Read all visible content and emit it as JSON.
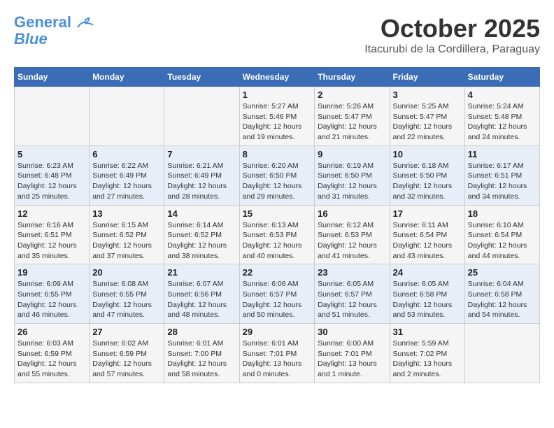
{
  "header": {
    "logo_line1": "General",
    "logo_line2": "Blue",
    "title": "October 2025",
    "subtitle": "Itacurubi de la Cordillera, Paraguay"
  },
  "weekdays": [
    "Sunday",
    "Monday",
    "Tuesday",
    "Wednesday",
    "Thursday",
    "Friday",
    "Saturday"
  ],
  "weeks": [
    [
      {
        "day": "",
        "info": ""
      },
      {
        "day": "",
        "info": ""
      },
      {
        "day": "",
        "info": ""
      },
      {
        "day": "1",
        "info": "Sunrise: 5:27 AM\nSunset: 5:46 PM\nDaylight: 12 hours\nand 19 minutes."
      },
      {
        "day": "2",
        "info": "Sunrise: 5:26 AM\nSunset: 5:47 PM\nDaylight: 12 hours\nand 21 minutes."
      },
      {
        "day": "3",
        "info": "Sunrise: 5:25 AM\nSunset: 5:47 PM\nDaylight: 12 hours\nand 22 minutes."
      },
      {
        "day": "4",
        "info": "Sunrise: 5:24 AM\nSunset: 5:48 PM\nDaylight: 12 hours\nand 24 minutes."
      }
    ],
    [
      {
        "day": "5",
        "info": "Sunrise: 6:23 AM\nSunset: 6:48 PM\nDaylight: 12 hours\nand 25 minutes."
      },
      {
        "day": "6",
        "info": "Sunrise: 6:22 AM\nSunset: 6:49 PM\nDaylight: 12 hours\nand 27 minutes."
      },
      {
        "day": "7",
        "info": "Sunrise: 6:21 AM\nSunset: 6:49 PM\nDaylight: 12 hours\nand 28 minutes."
      },
      {
        "day": "8",
        "info": "Sunrise: 6:20 AM\nSunset: 6:50 PM\nDaylight: 12 hours\nand 29 minutes."
      },
      {
        "day": "9",
        "info": "Sunrise: 6:19 AM\nSunset: 6:50 PM\nDaylight: 12 hours\nand 31 minutes."
      },
      {
        "day": "10",
        "info": "Sunrise: 6:18 AM\nSunset: 6:50 PM\nDaylight: 12 hours\nand 32 minutes."
      },
      {
        "day": "11",
        "info": "Sunrise: 6:17 AM\nSunset: 6:51 PM\nDaylight: 12 hours\nand 34 minutes."
      }
    ],
    [
      {
        "day": "12",
        "info": "Sunrise: 6:16 AM\nSunset: 6:51 PM\nDaylight: 12 hours\nand 35 minutes."
      },
      {
        "day": "13",
        "info": "Sunrise: 6:15 AM\nSunset: 6:52 PM\nDaylight: 12 hours\nand 37 minutes."
      },
      {
        "day": "14",
        "info": "Sunrise: 6:14 AM\nSunset: 6:52 PM\nDaylight: 12 hours\nand 38 minutes."
      },
      {
        "day": "15",
        "info": "Sunrise: 6:13 AM\nSunset: 6:53 PM\nDaylight: 12 hours\nand 40 minutes."
      },
      {
        "day": "16",
        "info": "Sunrise: 6:12 AM\nSunset: 6:53 PM\nDaylight: 12 hours\nand 41 minutes."
      },
      {
        "day": "17",
        "info": "Sunrise: 6:11 AM\nSunset: 6:54 PM\nDaylight: 12 hours\nand 43 minutes."
      },
      {
        "day": "18",
        "info": "Sunrise: 6:10 AM\nSunset: 6:54 PM\nDaylight: 12 hours\nand 44 minutes."
      }
    ],
    [
      {
        "day": "19",
        "info": "Sunrise: 6:09 AM\nSunset: 6:55 PM\nDaylight: 12 hours\nand 46 minutes."
      },
      {
        "day": "20",
        "info": "Sunrise: 6:08 AM\nSunset: 6:55 PM\nDaylight: 12 hours\nand 47 minutes."
      },
      {
        "day": "21",
        "info": "Sunrise: 6:07 AM\nSunset: 6:56 PM\nDaylight: 12 hours\nand 48 minutes."
      },
      {
        "day": "22",
        "info": "Sunrise: 6:06 AM\nSunset: 6:57 PM\nDaylight: 12 hours\nand 50 minutes."
      },
      {
        "day": "23",
        "info": "Sunrise: 6:05 AM\nSunset: 6:57 PM\nDaylight: 12 hours\nand 51 minutes."
      },
      {
        "day": "24",
        "info": "Sunrise: 6:05 AM\nSunset: 6:58 PM\nDaylight: 12 hours\nand 53 minutes."
      },
      {
        "day": "25",
        "info": "Sunrise: 6:04 AM\nSunset: 6:58 PM\nDaylight: 12 hours\nand 54 minutes."
      }
    ],
    [
      {
        "day": "26",
        "info": "Sunrise: 6:03 AM\nSunset: 6:59 PM\nDaylight: 12 hours\nand 55 minutes."
      },
      {
        "day": "27",
        "info": "Sunrise: 6:02 AM\nSunset: 6:59 PM\nDaylight: 12 hours\nand 57 minutes."
      },
      {
        "day": "28",
        "info": "Sunrise: 6:01 AM\nSunset: 7:00 PM\nDaylight: 12 hours\nand 58 minutes."
      },
      {
        "day": "29",
        "info": "Sunrise: 6:01 AM\nSunset: 7:01 PM\nDaylight: 13 hours\nand 0 minutes."
      },
      {
        "day": "30",
        "info": "Sunrise: 6:00 AM\nSunset: 7:01 PM\nDaylight: 13 hours\nand 1 minute."
      },
      {
        "day": "31",
        "info": "Sunrise: 5:59 AM\nSunset: 7:02 PM\nDaylight: 13 hours\nand 2 minutes."
      },
      {
        "day": "",
        "info": ""
      }
    ]
  ]
}
